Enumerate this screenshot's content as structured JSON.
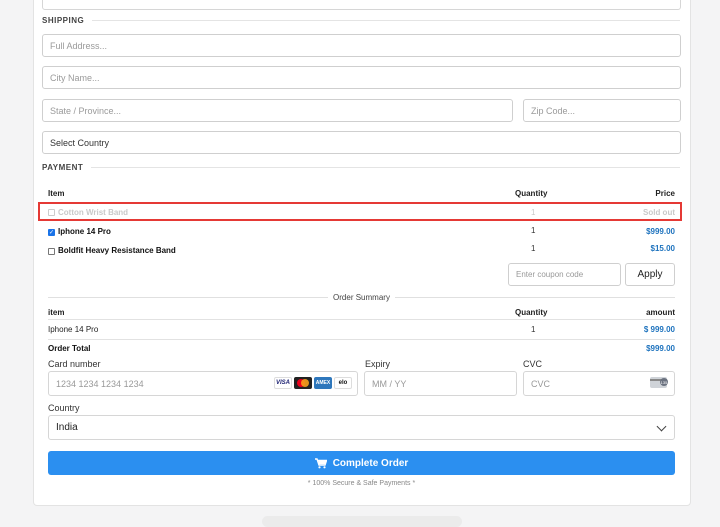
{
  "shipping": {
    "heading": "SHIPPING",
    "full_address_placeholder": "Full Address...",
    "city_placeholder": "City Name...",
    "state_placeholder": "State / Province...",
    "zip_placeholder": "Zip Code...",
    "country_select": "Select Country"
  },
  "payment": {
    "heading": "PAYMENT",
    "columns": {
      "item": "Item",
      "quantity": "Quantity",
      "price": "Price"
    },
    "items": [
      {
        "name": "Cotton Wrist Band",
        "quantity": "1",
        "price": "Sold out",
        "checked": false,
        "disabled": true
      },
      {
        "name": "Iphone 14 Pro",
        "quantity": "1",
        "price": "$999.00",
        "checked": true,
        "disabled": false
      },
      {
        "name": "Boldfit Heavy Resistance Band",
        "quantity": "1",
        "price": "$15.00",
        "checked": false,
        "disabled": false
      }
    ],
    "coupon_placeholder": "Enter coupon code",
    "apply_label": "Apply"
  },
  "summary": {
    "title": "Order Summary",
    "columns": {
      "item": "item",
      "quantity": "Quantity",
      "amount": "amount"
    },
    "row": {
      "item": "Iphone 14 Pro",
      "quantity": "1",
      "amount": "$ 999.00"
    },
    "total_label": "Order Total",
    "total_value": "$999.00"
  },
  "card": {
    "number_label": "Card number",
    "number_placeholder": "1234 1234 1234 1234",
    "expiry_label": "Expiry",
    "expiry_placeholder": "MM / YY",
    "cvc_label": "CVC",
    "cvc_placeholder": "CVC",
    "brand_icons": [
      "visa-icon",
      "mastercard-icon",
      "amex-icon",
      "elo-icon"
    ],
    "visa_text": "VISA",
    "amex_text": "AMEX",
    "elo_text": "elo",
    "cvc_icon_text": "135",
    "country_label": "Country",
    "country_value": "India"
  },
  "actions": {
    "complete_label": "Complete Order",
    "secure_note": "* 100% Secure & Safe Payments *"
  },
  "colors": {
    "accent": "#2b8ff0",
    "price": "#1e73be",
    "highlight": "#e53935"
  }
}
